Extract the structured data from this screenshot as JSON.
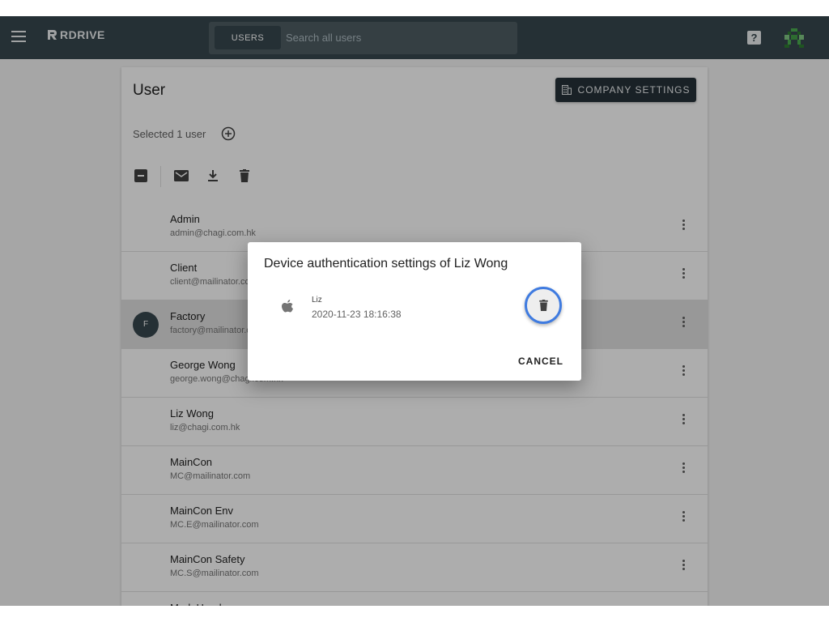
{
  "app": {
    "logo_text": "RDRIVE"
  },
  "search": {
    "scope_chip": "USERS",
    "placeholder": "Search all users"
  },
  "header": {
    "help_label": "?"
  },
  "page": {
    "title": "User",
    "company_settings_label": "COMPANY SETTINGS",
    "selected_text": "Selected 1 user"
  },
  "users": [
    {
      "name": "Admin",
      "email": "admin@chagi.com.hk",
      "selected": false
    },
    {
      "name": "Client",
      "email": "client@mailinator.com",
      "selected": false
    },
    {
      "name": "Factory",
      "email": "factory@mailinator.com",
      "selected": true,
      "avatar": "F"
    },
    {
      "name": "George Wong",
      "email": "george.wong@chagi.com.hk",
      "selected": false
    },
    {
      "name": "Liz Wong",
      "email": "liz@chagi.com.hk",
      "selected": false
    },
    {
      "name": "MainCon",
      "email": "MC@mailinator.com",
      "selected": false
    },
    {
      "name": "MainCon Env",
      "email": "MC.E@mailinator.com",
      "selected": false
    },
    {
      "name": "MainCon Safety",
      "email": "MC.S@mailinator.com",
      "selected": false
    },
    {
      "name": "Mark Henderson",
      "email": "",
      "selected": false
    }
  ],
  "dialog": {
    "title": "Device authentication settings of Liz Wong",
    "device_name": "Liz",
    "device_date": "2020-11-23 18:16:38",
    "cancel_label": "CANCEL"
  },
  "colors": {
    "appbar": "#37474f",
    "accent_ring": "#3f7be0",
    "avatar_green": "#4caf50"
  },
  "icons": [
    "menu-icon",
    "logo-icon",
    "help-icon",
    "avatar-icon",
    "building-icon",
    "add-circle-icon",
    "indeterminate-checkbox-icon",
    "mail-icon",
    "download-icon",
    "delete-icon",
    "more-vert-icon",
    "apple-icon"
  ]
}
